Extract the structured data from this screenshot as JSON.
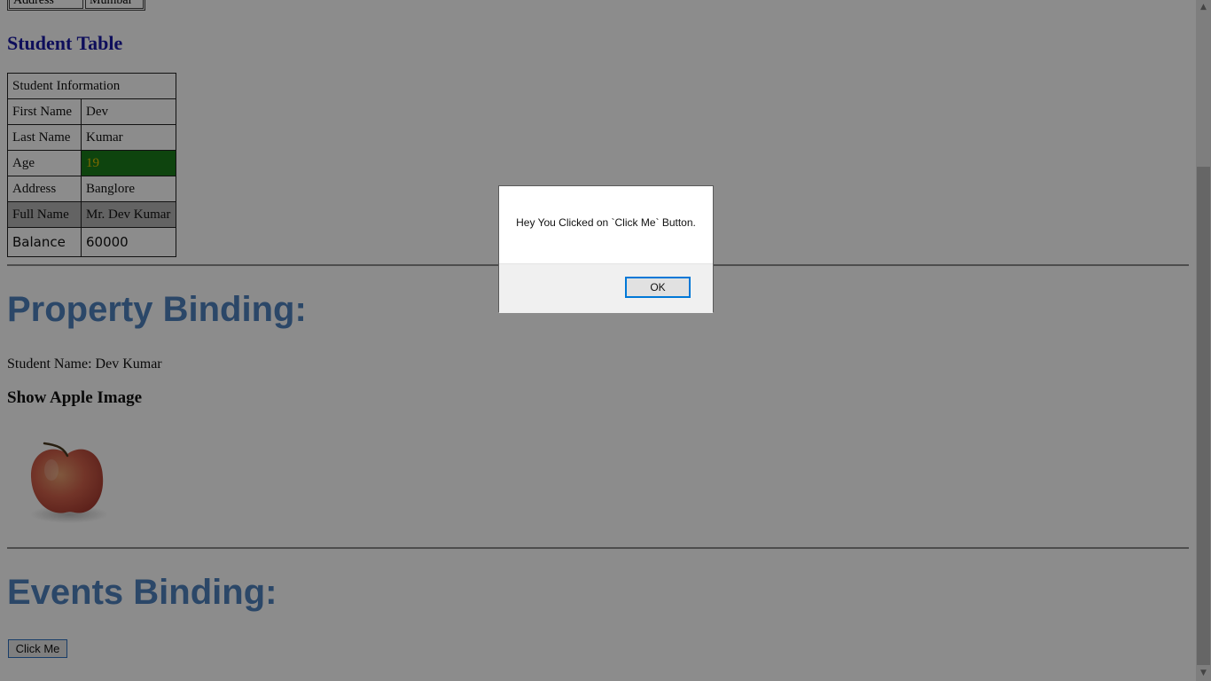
{
  "top_table_stub": [
    "Address",
    "Mumbai"
  ],
  "student_table": {
    "title": "Student Table",
    "caption": "Student Information",
    "rows": [
      {
        "label": "First Name",
        "value": "Dev"
      },
      {
        "label": "Last Name",
        "value": "Kumar"
      },
      {
        "label": "Age",
        "value": "19"
      },
      {
        "label": "Address",
        "value": "Banglore"
      },
      {
        "label": "Full Name",
        "value": "Mr. Dev Kumar"
      },
      {
        "label": "Balance",
        "value": "60000"
      }
    ]
  },
  "property_binding": {
    "heading": "Property Binding:",
    "student_name": "Student Name: Dev Kumar",
    "image_heading": "Show Apple Image"
  },
  "events_binding": {
    "heading": "Events Binding:",
    "button_label": "Click Me"
  },
  "alert_dialog": {
    "message": "Hey You Clicked on `Click Me` Button.",
    "ok_label": "OK"
  },
  "colors": {
    "heading_blue": "#4f81bd",
    "title_navy": "#1a1aa6",
    "age_cell_bg": "#1a7d1a",
    "age_cell_text": "#e6c200",
    "full_name_bg": "#b4b4b4",
    "overlay": "rgba(0,0,0,0.45)"
  },
  "icons": {
    "scroll_up": "scroll-up-arrow-icon",
    "scroll_down": "scroll-down-arrow-icon",
    "apple": "apple-image"
  }
}
